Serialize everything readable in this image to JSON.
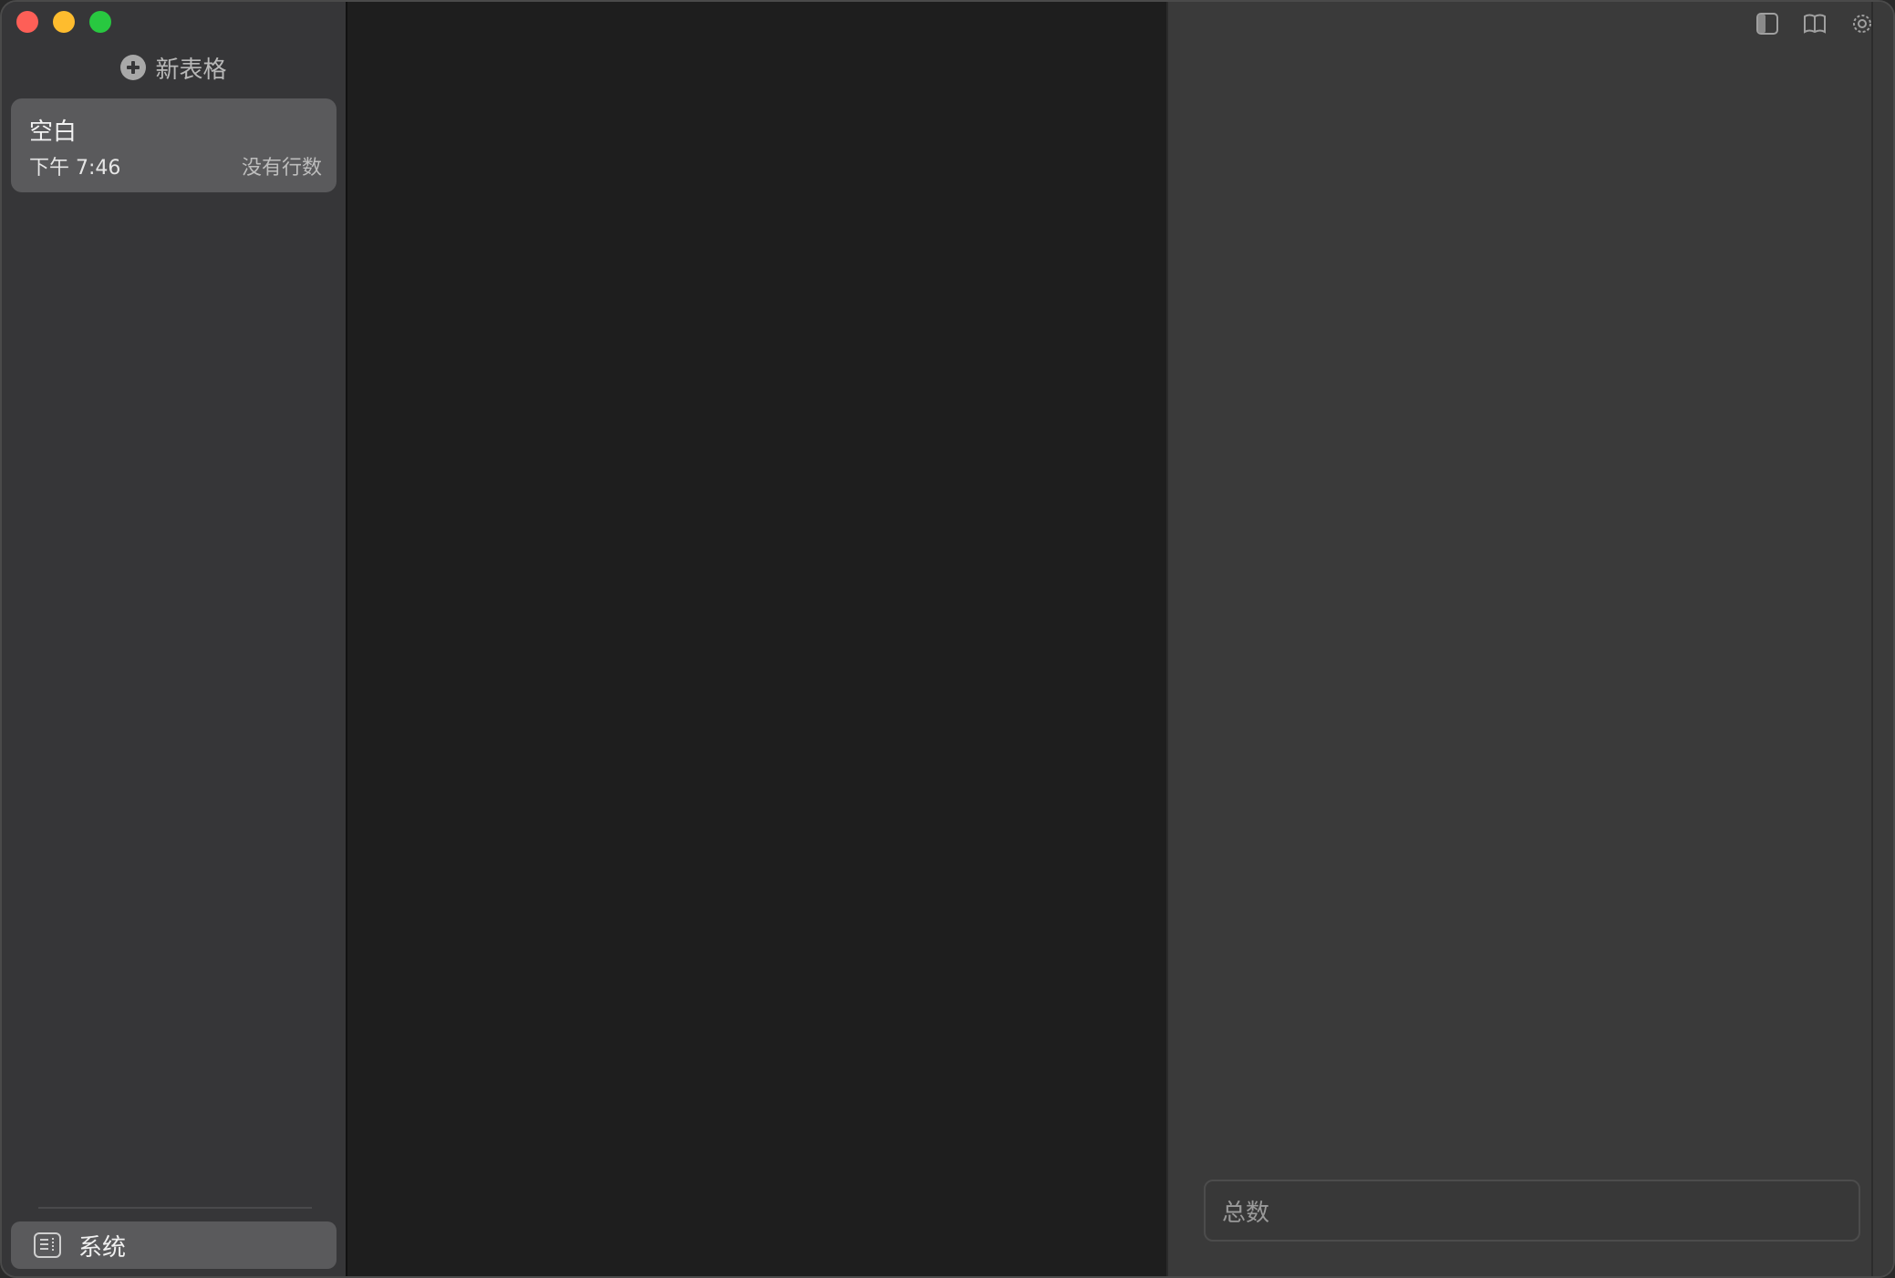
{
  "sidebar": {
    "new_sheet_label": "新表格",
    "sheets": [
      {
        "title": "空白",
        "time": "下午 7:46",
        "rows": "没有行数"
      }
    ],
    "footer_item_label": "系统"
  },
  "right_pane": {
    "total_label": "总数"
  },
  "colors": {
    "traffic_close": "#fe5f57",
    "traffic_minimize": "#febc2e",
    "traffic_maximize": "#28c840",
    "sidebar_bg": "#363638",
    "middle_bg": "#1e1e1e",
    "right_bg": "#3a3a3a"
  },
  "icons": {
    "new_sheet": "plus-circle-icon",
    "footer_item": "sidebar-panel-icon",
    "toolbar": [
      "sidebar-toggle-icon",
      "book-icon",
      "gear-icon"
    ]
  }
}
